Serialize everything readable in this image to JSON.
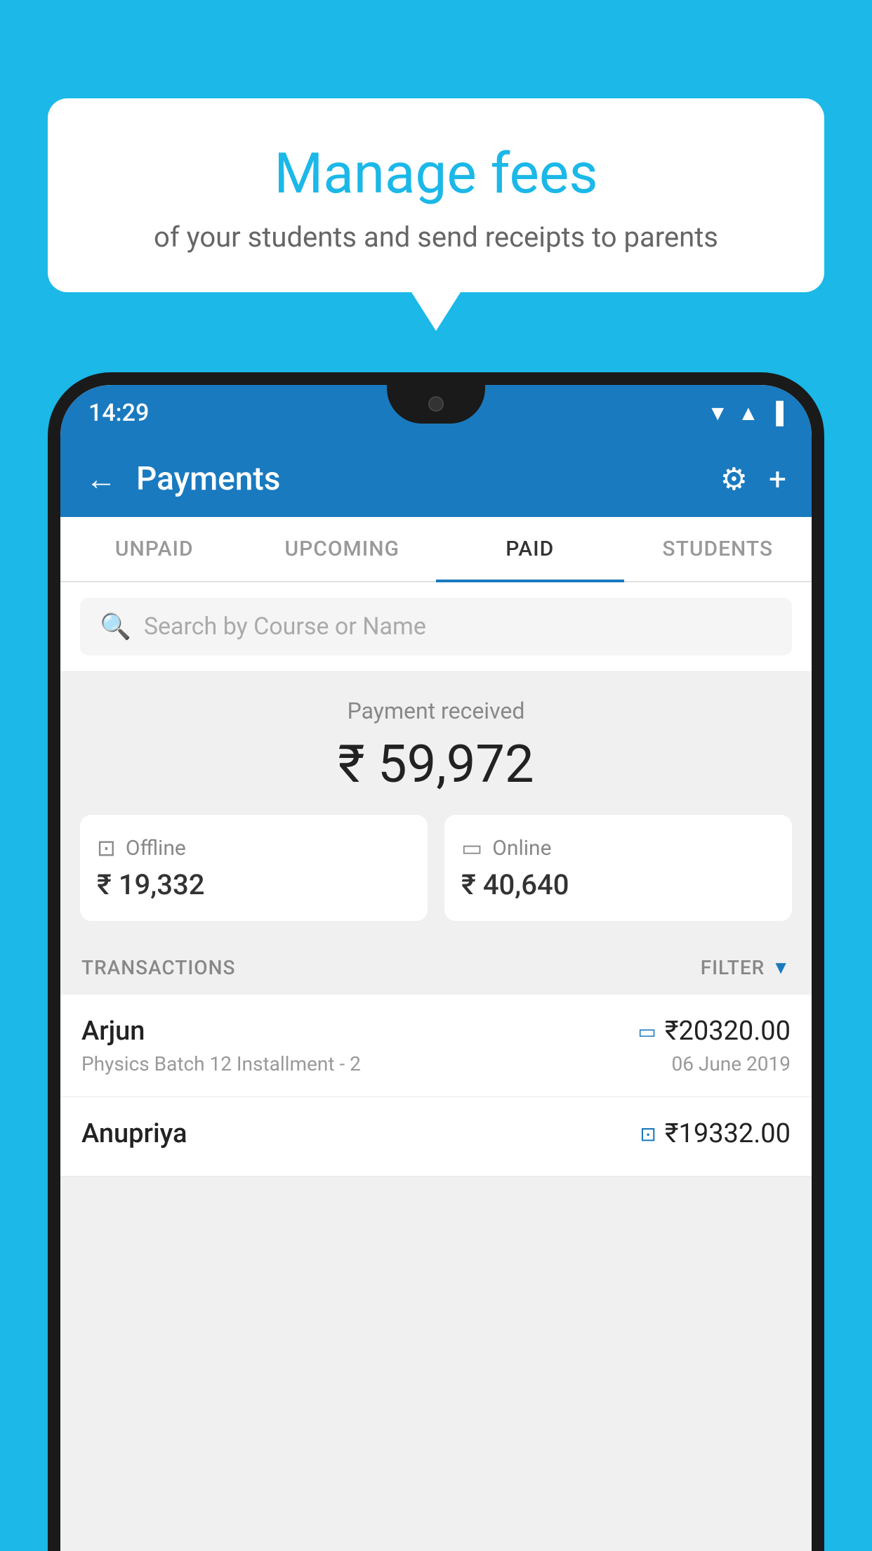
{
  "background_color": "#1bb8e8",
  "speech_bubble": {
    "title": "Manage fees",
    "subtitle": "of your students and send receipts to parents"
  },
  "status_bar": {
    "time": "14:29"
  },
  "header": {
    "title": "Payments",
    "back_label": "←",
    "settings_label": "⚙",
    "add_label": "+"
  },
  "tabs": [
    {
      "label": "UNPAID",
      "active": false
    },
    {
      "label": "UPCOMING",
      "active": false
    },
    {
      "label": "PAID",
      "active": true
    },
    {
      "label": "STUDENTS",
      "active": false
    }
  ],
  "search": {
    "placeholder": "Search by Course or Name"
  },
  "payment_summary": {
    "label": "Payment received",
    "amount": "₹ 59,972",
    "offline": {
      "type": "Offline",
      "amount": "₹ 19,332"
    },
    "online": {
      "type": "Online",
      "amount": "₹ 40,640"
    }
  },
  "transactions_section": {
    "label": "TRANSACTIONS",
    "filter_label": "FILTER"
  },
  "transactions": [
    {
      "name": "Arjun",
      "amount": "₹20320.00",
      "course": "Physics Batch 12 Installment - 2",
      "date": "06 June 2019",
      "type": "online"
    },
    {
      "name": "Anupriya",
      "amount": "₹19332.00",
      "course": "",
      "date": "",
      "type": "offline"
    }
  ]
}
